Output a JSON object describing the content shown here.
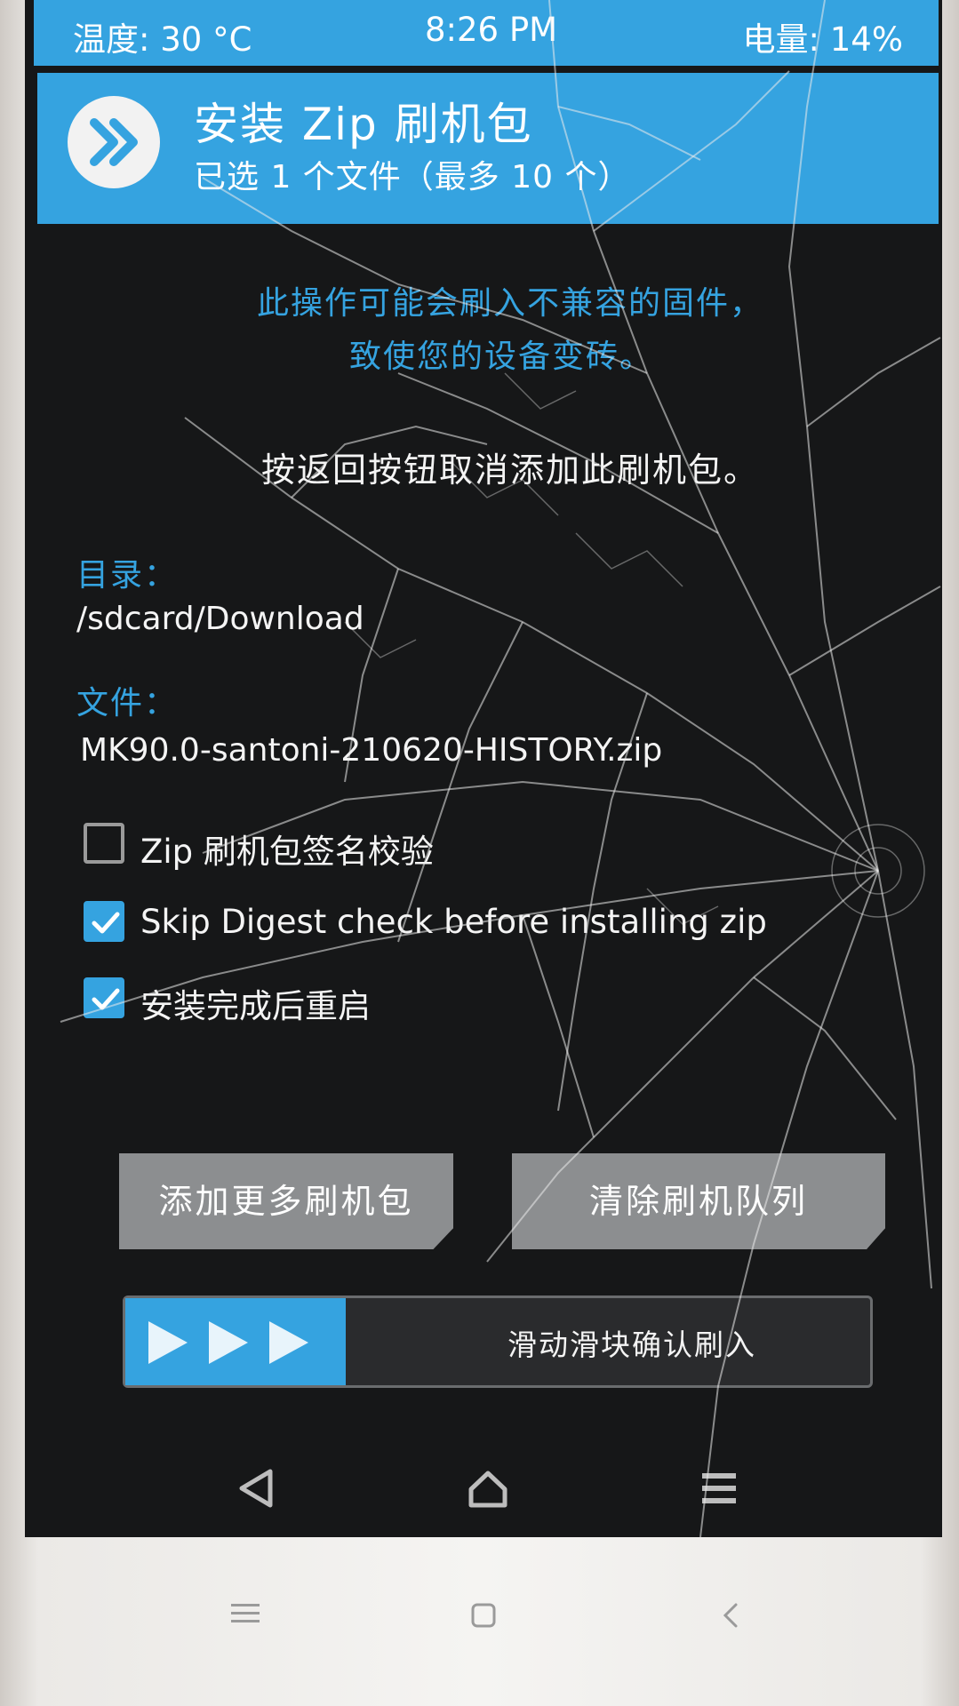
{
  "status_bar": {
    "temperature": "温度: 30 °C",
    "time": "8:26 PM",
    "battery": "电量: 14%"
  },
  "header": {
    "title": "安装 Zip 刷机包",
    "subtitle": "已选 1 个文件（最多 10 个）",
    "logo_icon": "twrp-logo-icon"
  },
  "warning": {
    "line1": "此操作可能会刷入不兼容的固件，",
    "line2": "致使您的设备变砖。"
  },
  "cancel_hint": "按返回按钮取消添加此刷机包。",
  "directory": {
    "label": "目录：",
    "value": "/sdcard/Download"
  },
  "file": {
    "label": "文件：",
    "value": "MK90.0-santoni-210620-HISTORY.zip"
  },
  "options": [
    {
      "label": "Zip 刷机包签名校验",
      "checked": false
    },
    {
      "label": "Skip Digest check before installing zip",
      "checked": true
    },
    {
      "label": "安装完成后重启",
      "checked": true
    }
  ],
  "buttons": {
    "add_more": "添加更多刷机包",
    "clear_queue": "清除刷机队列"
  },
  "slider": {
    "label": "滑动滑块确认刷入",
    "handle_icon": "triple-arrow-icon"
  },
  "nav": {
    "back_icon": "back-triangle-icon",
    "home_icon": "home-icon",
    "menu_icon": "log-menu-icon"
  },
  "colors": {
    "accent": "#35a3e0",
    "background": "#161718",
    "button": "#8c8e90"
  }
}
